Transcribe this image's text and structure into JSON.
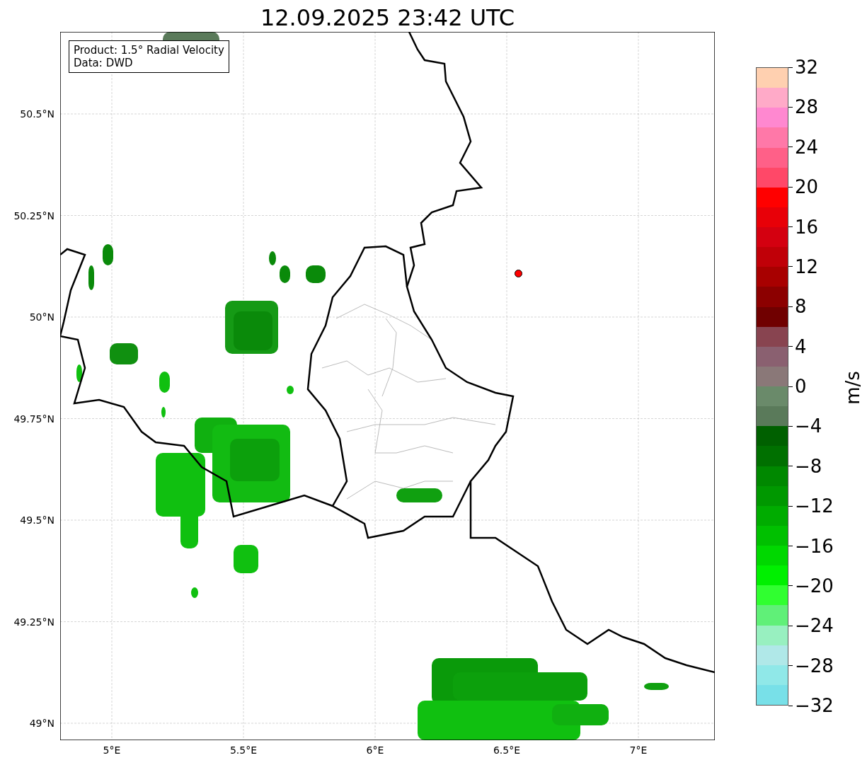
{
  "title": "12.09.2025 23:42 UTC",
  "info_box": {
    "lines": [
      "Product: 1.5° Radial Velocity",
      "Data: DWD"
    ]
  },
  "map": {
    "lat_labels": [
      "50.5°N",
      "50.25°N",
      "50°N",
      "49.75°N",
      "49.5°N",
      "49.25°N",
      "49°N"
    ],
    "lon_labels": [
      "5°E",
      "5.5°E",
      "6°E",
      "6.5°E",
      "7°E"
    ]
  },
  "colorbar": {
    "label": "m/s",
    "ticks": [
      "32",
      "28",
      "24",
      "20",
      "16",
      "12",
      "8",
      "4",
      "0",
      "−4",
      "−8",
      "−12",
      "−16",
      "−20",
      "−24",
      "−28",
      "−32"
    ],
    "bins": [
      {
        "color": "#ffd0b0"
      },
      {
        "color": "#ffaac8"
      },
      {
        "color": "#ff88d0"
      },
      {
        "color": "#ff78a8"
      },
      {
        "color": "#ff6088"
      },
      {
        "color": "#ff4868"
      },
      {
        "color": "#ff0000"
      },
      {
        "color": "#e80008"
      },
      {
        "color": "#d40010"
      },
      {
        "color": "#c00008"
      },
      {
        "color": "#a80000"
      },
      {
        "color": "#8c0000"
      },
      {
        "color": "#700000"
      },
      {
        "color": "#884450"
      },
      {
        "color": "#8a6070"
      },
      {
        "color": "#8a7878"
      },
      {
        "color": "#6a8a6a"
      },
      {
        "color": "#5a7a5a"
      },
      {
        "color": "#006000"
      },
      {
        "color": "#007000"
      },
      {
        "color": "#008800"
      },
      {
        "color": "#009800"
      },
      {
        "color": "#00ac00"
      },
      {
        "color": "#00c000"
      },
      {
        "color": "#00d800"
      },
      {
        "color": "#00f000"
      },
      {
        "color": "#30ff30"
      },
      {
        "color": "#60f078"
      },
      {
        "color": "#98f0c0"
      },
      {
        "color": "#b0e8e8"
      },
      {
        "color": "#90e8e8"
      },
      {
        "color": "#78e0e8"
      }
    ]
  }
}
